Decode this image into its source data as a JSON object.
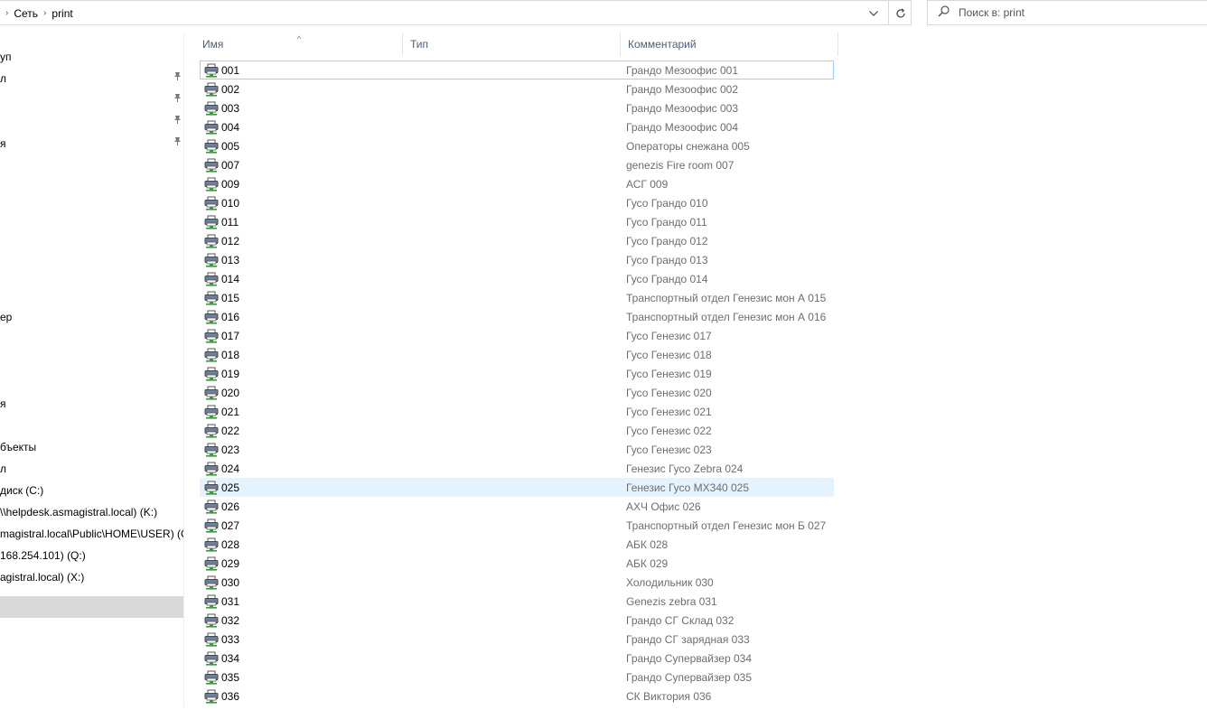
{
  "breadcrumb": [
    "Сеть",
    "print"
  ],
  "search": {
    "placeholder": "Поиск в: print"
  },
  "nav": {
    "items": [
      {
        "label": "уп",
        "pinned": false
      },
      {
        "label": "л",
        "pinned": true
      },
      {
        "label": "",
        "pinned": true
      },
      {
        "label": "",
        "pinned": true
      },
      {
        "label": "я",
        "pinned": true
      },
      {
        "label": "ер",
        "pinned": false
      },
      {
        "label": "я",
        "pinned": false
      },
      {
        "label": "бъекты",
        "pinned": false
      },
      {
        "label": "л",
        "pinned": false
      },
      {
        "label": "диск (C:)",
        "pinned": false
      },
      {
        "label": "\\\\helpdesk.asmagistral.local) (K:)",
        "pinned": false
      },
      {
        "label": "magistral.local\\Public\\HOME\\USER) (O",
        "pinned": false
      },
      {
        "label": "168.254.101) (Q:)",
        "pinned": false
      },
      {
        "label": "agistral.local) (X:)",
        "pinned": false
      },
      {
        "label": "",
        "pinned": false
      }
    ]
  },
  "columns": {
    "name": "Имя",
    "type": "Тип",
    "comment": "Комментарий"
  },
  "rows": [
    {
      "name": "001",
      "comment": "Грандо Мезоофис  001"
    },
    {
      "name": "002",
      "comment": "Грандо Мезоофис  002"
    },
    {
      "name": "003",
      "comment": "Грандо Мезоофис  003"
    },
    {
      "name": "004",
      "comment": "Грандо Мезоофис  004"
    },
    {
      "name": "005",
      "comment": "Операторы снежана 005"
    },
    {
      "name": "007",
      "comment": "genezis Fire room 007"
    },
    {
      "name": "009",
      "comment": "АСГ 009"
    },
    {
      "name": "010",
      "comment": "Гусо Грандо 010"
    },
    {
      "name": "011",
      "comment": "Гусо Грандо 011"
    },
    {
      "name": "012",
      "comment": "Гусо Грандо 012"
    },
    {
      "name": "013",
      "comment": "Гусо Грандо 013"
    },
    {
      "name": "014",
      "comment": "Гусо Грандо 014"
    },
    {
      "name": "015",
      "comment": "Транспортный отдел Генезис мон А 015"
    },
    {
      "name": "016",
      "comment": "Транспортный отдел Генезис мон А 016"
    },
    {
      "name": "017",
      "comment": "Гусо Генезис 017"
    },
    {
      "name": "018",
      "comment": "Гусо Генезис 018"
    },
    {
      "name": "019",
      "comment": "Гусо Генезис 019"
    },
    {
      "name": "020",
      "comment": "Гусо Генезис 020"
    },
    {
      "name": "021",
      "comment": "Гусо Генезис 021"
    },
    {
      "name": "022",
      "comment": "Гусо Генезис 022"
    },
    {
      "name": "023",
      "comment": "Гусо Генезис 023"
    },
    {
      "name": "024",
      "comment": "Генезис Гусо Zebra 024"
    },
    {
      "name": "025",
      "comment": "Генезис Гусо MX340 025"
    },
    {
      "name": "026",
      "comment": "АХЧ Офис 026"
    },
    {
      "name": "027",
      "comment": "Транспортный отдел Генезис мон Б 027"
    },
    {
      "name": "028",
      "comment": "АБК 028"
    },
    {
      "name": "029",
      "comment": "АБК 029"
    },
    {
      "name": "030",
      "comment": "Холодильник  030"
    },
    {
      "name": "031",
      "comment": "Genezis zebra 031"
    },
    {
      "name": "032",
      "comment": "Грандо СГ Склад 032"
    },
    {
      "name": "033",
      "comment": "Грандо СГ  зарядная 033"
    },
    {
      "name": "034",
      "comment": "Грандо Супервайзер 034"
    },
    {
      "name": "035",
      "comment": "Грандо Супервайзер 035"
    },
    {
      "name": "036",
      "comment": "СК Виктория 036"
    }
  ],
  "focused_row": "001",
  "hover_row": "025",
  "icon": "network-printer-icon",
  "colors": {
    "header_text": "#4c607a",
    "hover": "#e5f3ff",
    "focus_border": "#99d1ff",
    "comment_text": "#6d6d6d"
  }
}
